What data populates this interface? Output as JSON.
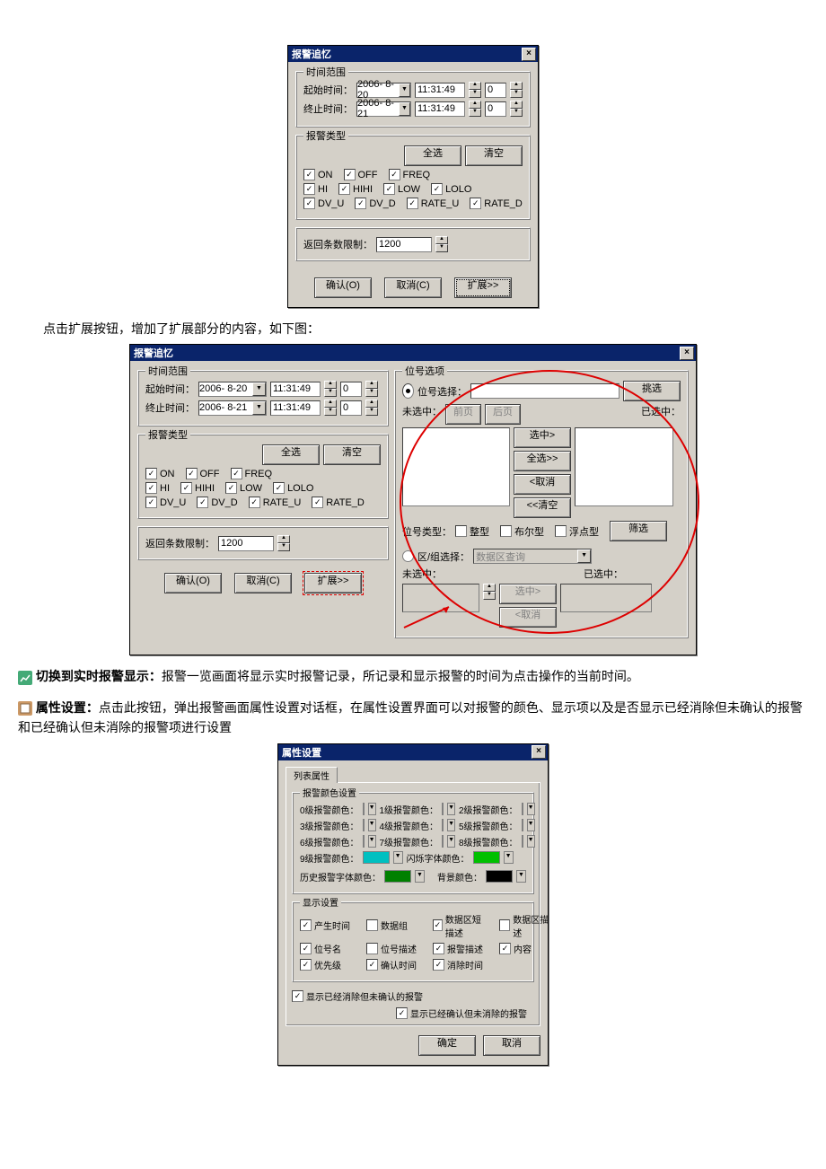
{
  "dialog1": {
    "title": "报警追忆",
    "timeGroup": {
      "title": "时间范围",
      "startLabel": "起始时间：",
      "endLabel": "终止时间：",
      "startDate": "2006- 8-20",
      "endDate": "2006- 8-21",
      "startTime": "11:31:49",
      "endTime": "11:31:49",
      "startMs": "0",
      "endMs": "0"
    },
    "alarmGroup": {
      "title": "报警类型",
      "selectAll": "全选",
      "clear": "清空",
      "items": [
        {
          "label": "ON",
          "checked": true
        },
        {
          "label": "OFF",
          "checked": true
        },
        {
          "label": "FREQ",
          "checked": true
        }
      ],
      "items2": [
        {
          "label": "HI",
          "checked": true
        },
        {
          "label": "HIHI",
          "checked": true
        },
        {
          "label": "LOW",
          "checked": true
        },
        {
          "label": "LOLO",
          "checked": true
        }
      ],
      "items3": [
        {
          "label": "DV_U",
          "checked": true
        },
        {
          "label": "DV_D",
          "checked": true
        },
        {
          "label": "RATE_U",
          "checked": true
        },
        {
          "label": "RATE_D",
          "checked": true
        }
      ]
    },
    "limitLabel": "返回条数限制：",
    "limitValue": "1200",
    "ok": "确认(O)",
    "cancel": "取消(C)",
    "expand": "扩展>>"
  },
  "caption1": "点击扩展按钮，增加了扩展部分的内容，如下图：",
  "dialog2": {
    "title": "报警追忆",
    "extra": {
      "groupTitle": "位号选项",
      "radioTag": "位号选择：",
      "pickBtn": "挑选",
      "unselected": "未选中：",
      "prev": "前页",
      "next": "后页",
      "selected": "已选中：",
      "btnSel": "选中>",
      "btnAll": "全选>>",
      "btnUnsel": "<取消",
      "btnClear": "<<清空",
      "tagTypeLabel": "位号类型：",
      "t_int": "整型",
      "t_bool": "布尔型",
      "t_float": "浮点型",
      "filterBtn": "筛选",
      "radioReg": "区/组选择：",
      "regVal": "数据区查询",
      "unselected2": "未选中：",
      "selected2": "已选中："
    }
  },
  "para2_prefix": "切换到实时报警显示：",
  "para2_body": "报警一览画面将显示实时报警记录，所记录和显示报警的时间为点击操作的当前时间。",
  "para3_prefix": "属性设置：",
  "para3_body": "点击此按钮，弹出报警画面属性设置对话框，在属性设置界面可以对报警的颜色、显示项以及是否显示已经消除但未确认的报警和已经确认但未消除的报警项进行设置",
  "dialog3": {
    "title": "属性设置",
    "tab": "列表属性",
    "colorGroup": "报警颜色设置",
    "rows": [
      [
        {
          "l": "0级报警颜色：",
          "c": "#ff8080"
        },
        {
          "l": "1级报警颜色：",
          "c": "#ff00ff"
        },
        {
          "l": "2级报警颜色：",
          "c": "#0000ff"
        }
      ],
      [
        {
          "l": "3级报警颜色：",
          "c": "#ffff00"
        },
        {
          "l": "4级报警颜色：",
          "c": "#ff00ff"
        },
        {
          "l": "5级报警颜色：",
          "c": "#ffff00"
        }
      ],
      [
        {
          "l": "6级报警颜色：",
          "c": "#ffff00"
        },
        {
          "l": "7级报警颜色：",
          "c": "#ffff00"
        },
        {
          "l": "8级报警颜色：",
          "c": "#ffff00"
        }
      ],
      [
        {
          "l": "9级报警颜色：",
          "c": "#00c0c0"
        },
        {
          "l": "闪烁字体颜色：",
          "c": "#00c000"
        }
      ]
    ],
    "histLabel": "历史报警字体颜色：",
    "histColor": "#008000",
    "bgLabel": "背景颜色：",
    "bgColor": "#000000",
    "dispGroup": "显示设置",
    "disp": [
      [
        {
          "l": "产生时间",
          "c": true
        },
        {
          "l": "数据组",
          "c": false
        },
        {
          "l": "数据区短描述",
          "c": true
        },
        {
          "l": "数据区描述",
          "c": false
        }
      ],
      [
        {
          "l": "位号名",
          "c": true
        },
        {
          "l": "位号描述",
          "c": false
        },
        {
          "l": "报警描述",
          "c": true
        },
        {
          "l": "内容",
          "c": true
        }
      ],
      [
        {
          "l": "优先级",
          "c": true
        },
        {
          "l": "确认时间",
          "c": true
        },
        {
          "l": "消除时间",
          "c": true
        }
      ]
    ],
    "opt1": "显示已经消除但未确认的报警",
    "opt2": "显示已经确认但未消除的报警",
    "ok": "确定",
    "cancel": "取消"
  }
}
